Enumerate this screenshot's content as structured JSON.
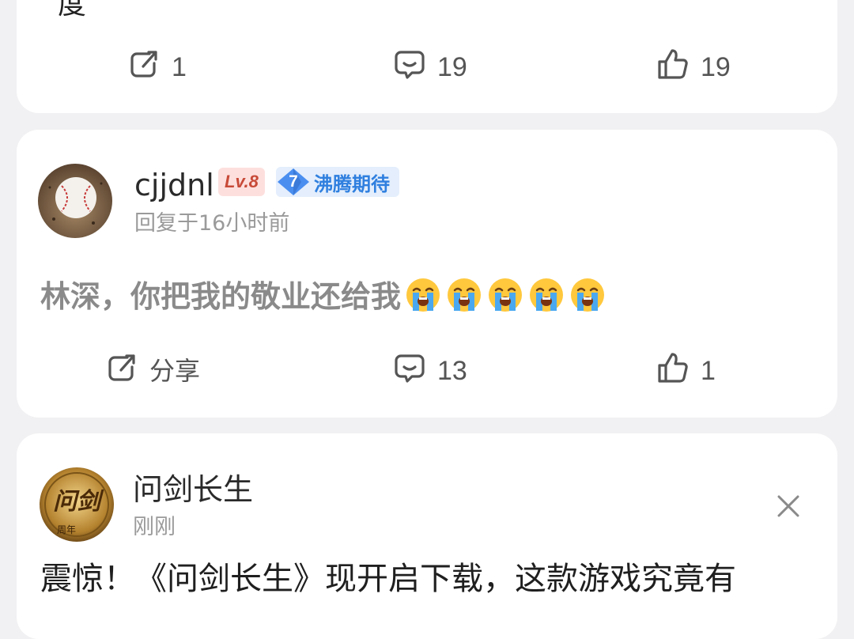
{
  "top_card": {
    "partial_text": "度",
    "actions": [
      {
        "icon": "share-icon",
        "label": "1"
      },
      {
        "icon": "comment-icon",
        "label": "19"
      },
      {
        "icon": "thumbs-up-icon",
        "label": "19"
      }
    ]
  },
  "comment_card": {
    "username": "cjjdnl",
    "level": "Lv.8",
    "tag_level": "7",
    "tag_text": "沸腾期待",
    "timestamp": "回复于16小时前",
    "text": "林深，你把我的敬业还给我",
    "emoji_name": "loudly-crying-face",
    "emoji_count": 5,
    "actions": [
      {
        "icon": "share-icon",
        "label": "分享"
      },
      {
        "icon": "comment-icon",
        "label": "13"
      },
      {
        "icon": "thumbs-up-icon",
        "label": "1"
      }
    ]
  },
  "ad_card": {
    "name": "问剑长生",
    "avatar_text": "问剑",
    "avatar_sub": "周年",
    "timestamp": "刚刚",
    "headline": "震惊！《问剑长生》现开启下载，这款游戏究竟有",
    "close_icon": "close-icon"
  },
  "colors": {
    "background": "#f1f1f3",
    "card": "#ffffff",
    "level_badge_bg": "#fde0de",
    "level_badge_text": "#c84a38",
    "tag_bg": "#e4eefc",
    "tag_text": "#2f7fdf"
  }
}
